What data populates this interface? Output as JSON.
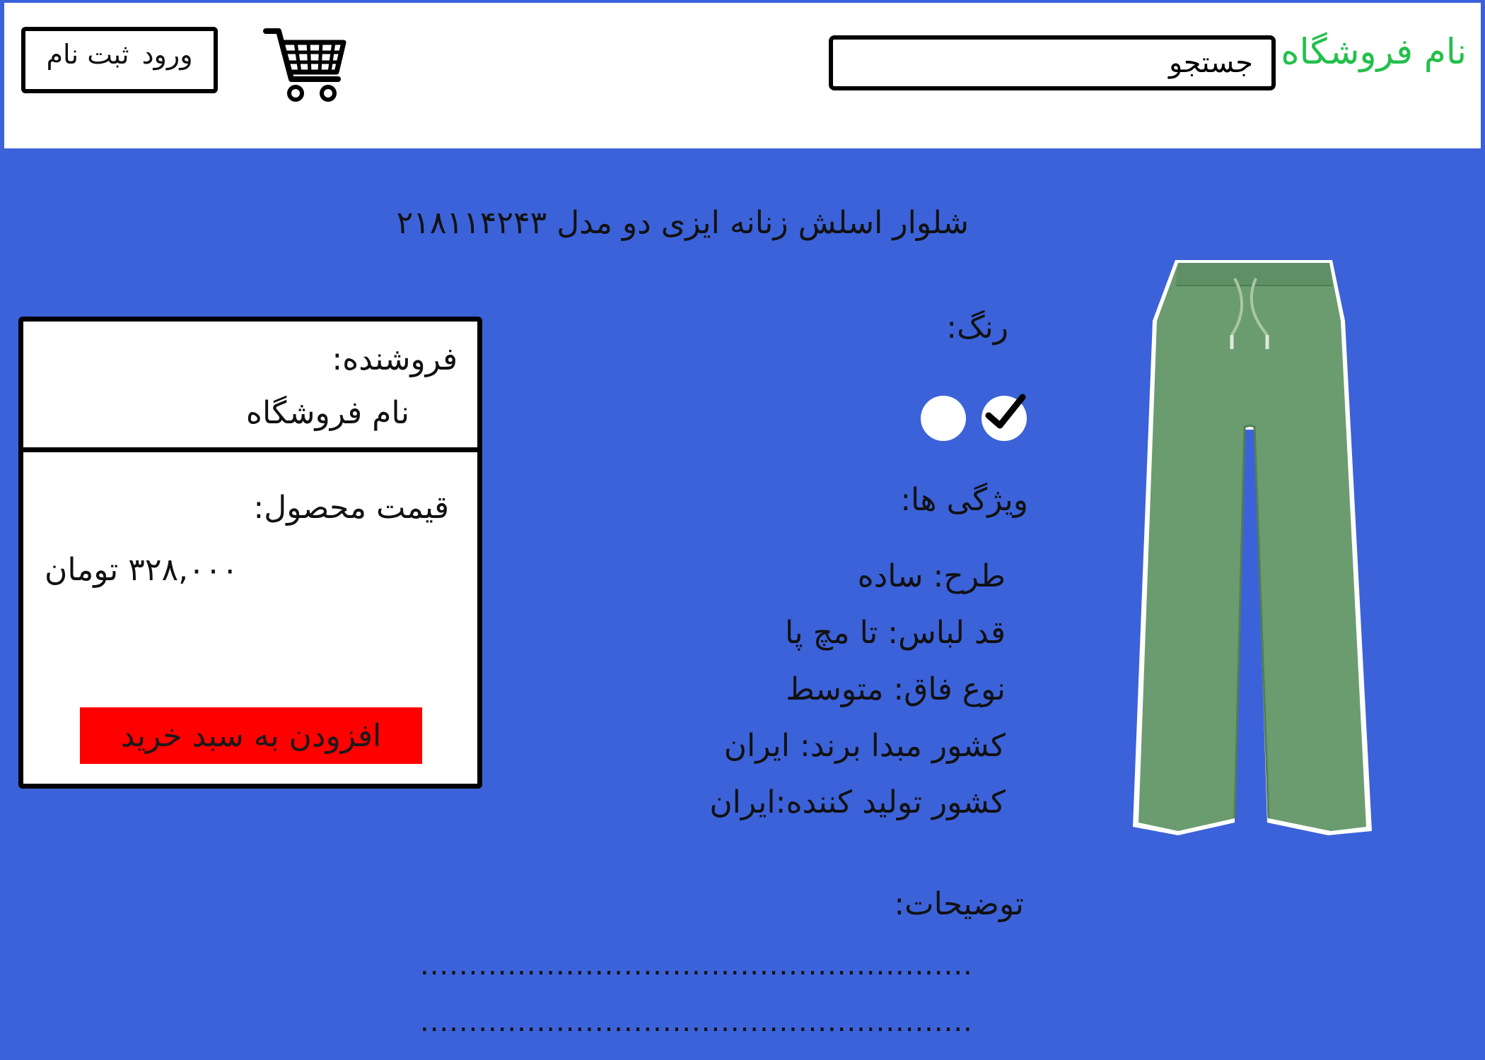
{
  "header": {
    "store_name": "نام فروشگاه",
    "search_placeholder": "جستجو",
    "login_label": "ورود",
    "register_label": "ثبت نام"
  },
  "product": {
    "title": "شلوار اسلش زنانه ایزی دو مدل ۲۱۸۱۱۴۲۴۳",
    "color_label": "رنگ:",
    "colors": [
      {
        "name": "green",
        "hex": "#6a9c6f",
        "selected": true
      },
      {
        "name": "white",
        "hex": "#ffffff",
        "selected": false
      }
    ],
    "features_label": "ویژگی ها:",
    "specs": [
      "طرح: ساده",
      "قد لباس: تا مچ پا",
      "نوع فاق: متوسط",
      "کشور مبدا برند: ایران",
      "کشور تولید کننده:ایران"
    ],
    "description_label": "توضیحات:",
    "description_lines": [
      "..................................................................................",
      ".................................................................................."
    ]
  },
  "seller_panel": {
    "seller_label": "فروشنده:",
    "seller_name": "نام فروشگاه",
    "price_label": "قیمت محصول:",
    "price": "۳۲۸,۰۰۰ تومان",
    "add_to_cart": "افزودن به سبد خرید"
  },
  "colors": {
    "background": "#3c62d9",
    "brand": "#22c04a",
    "add_button": "#ff0000",
    "pants": "#6a9c6f"
  },
  "icons": {
    "cart": "shopping-cart-icon",
    "check": "checkmark-icon"
  }
}
